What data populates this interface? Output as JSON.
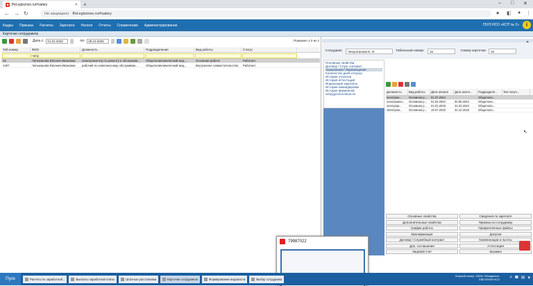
{
  "browser": {
    "tab_title": "fhd.egisznso.ru/#salary",
    "address_warning": "Не защищено",
    "url": "fhd.egisznso.ru/#salary"
  },
  "menu": [
    "Кадры",
    "Приказы",
    "Расчеты",
    "Зарплата",
    "Налоги",
    "Отчеты",
    "Справочники",
    "Администрирование"
  ],
  "org": "ГБУЗ НСО «КСП № 2»",
  "window_title": "Карточки сотрудников",
  "filter": {
    "date_from_label": "Дата с:",
    "date_from": "01.01.2020",
    "date_to_label": "по:",
    "date_to": "09.10.2025",
    "shown": "Показано 1-2 из 2"
  },
  "grid": {
    "headers": [
      "Таб.номер",
      "ФИО",
      "Должность",
      "Подразделение",
      "Вид работы",
      "Статус"
    ],
    "filter_value": "чепу",
    "rows": [
      [
        "16",
        "Чепыханова Евгения Ивановна",
        "электромонтер по ремонту и обслужива...",
        "Общеполиклинический мед...",
        "Основная работа",
        "Работает"
      ],
      [
        "1407",
        "Чепыханова Евгения Ивановна",
        "рабочий по комплексному обслуживан...",
        "Общеполиклинический мед...",
        "Внутреннее совместительство",
        "Работает"
      ]
    ]
  },
  "card": {
    "emp_label": "Сотрудник:",
    "emp_value": "Чепуштанова Е. И.",
    "tab_label": "Табельный номер:",
    "tab_value": "16",
    "card_label": "Номер карточки:",
    "card_value": "16"
  },
  "nav": [
    "Основные свойства",
    "Договор / Служ. контракт",
    "Назначения / Перемещения",
    "Количество дней отпуска",
    "История отпусков",
    "История аттестаций",
    "Индексация зарплаты",
    "История командировок",
    "История временной нетрудоспособности"
  ],
  "subtable": {
    "headers": [
      "Должность",
      "Вид работы",
      "Дата начала",
      "Дата оконч...",
      "Подразделе...",
      "Тип получ..."
    ],
    "rows": [
      [
        "электром...",
        "Основная р...",
        "01.07.2024",
        "",
        "Общеполи...",
        ""
      ],
      [
        "электромон...",
        "Основная р...",
        "01.04.2022",
        "30.06.2024",
        "Общеполи...",
        ""
      ],
      [
        "электром...",
        "Основная р...",
        "01.01.2019",
        "31.03.2022",
        "Общеполи...",
        ""
      ],
      [
        "Электром...",
        "Основная р...",
        "19.07.2016",
        "31.12.2018",
        "Общеполи...",
        ""
      ]
    ]
  },
  "buttons": [
    [
      "Основные свойства",
      "Сведения по зарплате"
    ],
    [
      "Дополнительные свойства",
      "Приказы по сотруднику"
    ],
    [
      "График работы",
      "Прикрепленные файлы"
    ],
    [
      "Квалификация",
      "Допуски"
    ],
    [
      "Договор / Служебный контракт",
      "Компенсации и льготы"
    ],
    [
      "Доп. соглашения",
      "Аттестация"
    ],
    [
      "Лицевой счет",
      "Экзамен"
    ]
  ],
  "popup": {
    "title": "79987022"
  },
  "taskbar": {
    "start": "Пуск",
    "items": [
      "Расчеты по заработной...",
      "Выплаты заработной платы",
      "Штатные расстановки",
      "Карточки сотрудников",
      "Формирование ведомости",
      "Выбор сотрудника"
    ]
  },
  "sysinfo": [
    "Лицевой номер: 11626; Обладатель:",
    "ЕВЕГЕНИЯ НСО"
  ]
}
